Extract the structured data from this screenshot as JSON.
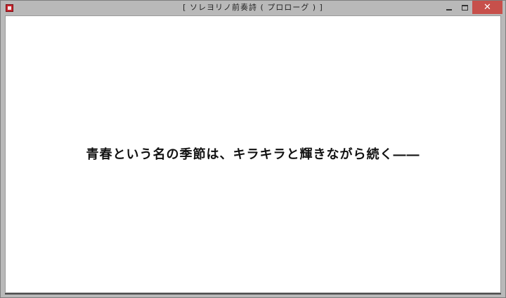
{
  "window": {
    "title": "[ ソレヨリノ前奏詩 ( プロローグ ) ]",
    "icon": "app-icon",
    "controls": {
      "minimize": "minimize-icon",
      "maximize": "maximize-icon",
      "close_label": "✕"
    },
    "colors": {
      "titlebar": "#b9b9b9",
      "close_button": "#c7504b",
      "client_background": "#ffffff"
    }
  },
  "content": {
    "message": "青春という名の季節は、キラキラと輝きながら続く――"
  }
}
